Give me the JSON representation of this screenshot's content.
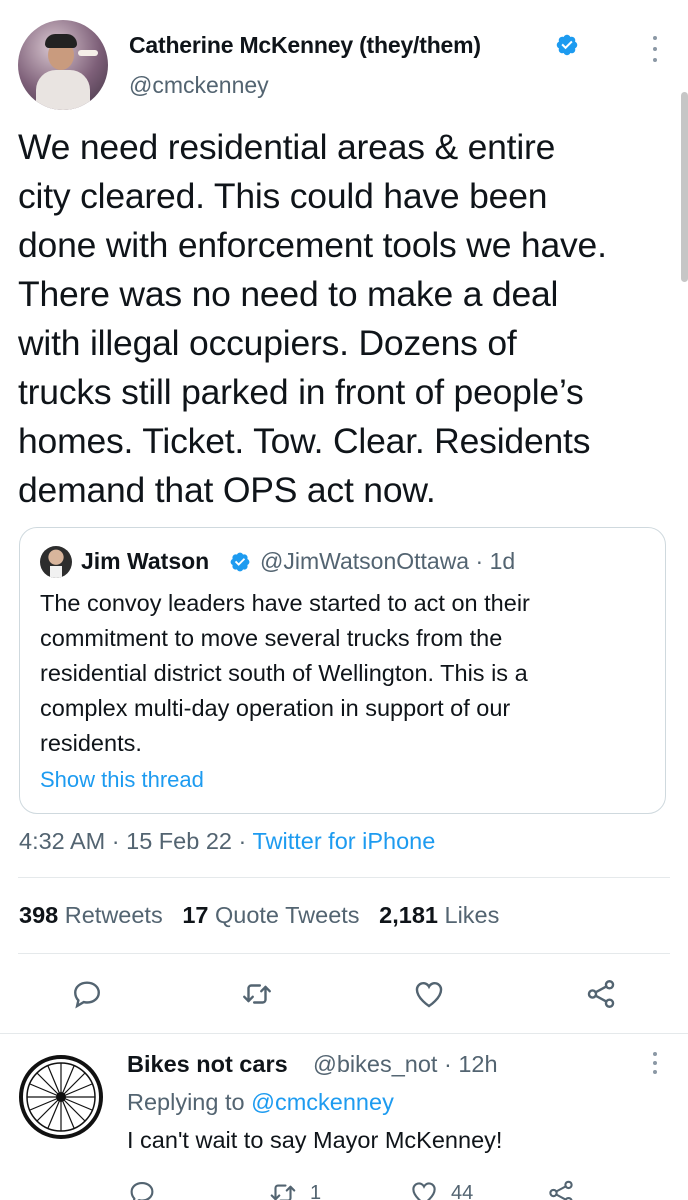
{
  "tweet": {
    "author_name": "Catherine McKenney (they/them)",
    "author_handle": "@cmckenney",
    "text": "We need residential areas & entire\ncity cleared. This could have been\ndone with enforcement tools we have.\nThere was no need to make a deal\nwith illegal occupiers. Dozens of\ntrucks still parked in front of people’s\nhomes. Ticket. Tow. Clear. Residents\ndemand that OPS act now.",
    "time": "4:32 AM",
    "date": "15 Feb 22",
    "source": "Twitter for iPhone",
    "retweets_count": "398",
    "retweets_label": "Retweets",
    "quotes_count": "17",
    "quotes_label": "Quote Tweets",
    "likes_count": "2,181",
    "likes_label": "Likes"
  },
  "quote": {
    "author_name": "Jim Watson",
    "author_handle": "@JimWatsonOttawa",
    "age": "1d",
    "text": "The convoy leaders have started to act on their\ncommitment to move several trucks from the\nresidential district south of Wellington. This is a\ncomplex multi-day operation in support of our\nresidents.",
    "show_thread": "Show this thread"
  },
  "reply": {
    "author_name": "Bikes not cars",
    "author_handle": "@bikes_not",
    "age": "12h",
    "replying_prefix": "Replying to",
    "replying_to": "@cmckenney",
    "text": "I can't wait to say Mayor McKenney!",
    "retweets": "1",
    "likes": "44"
  },
  "colors": {
    "text": "#0f1419",
    "secondary": "#536471",
    "accent": "#1d9bf0",
    "border": "#cfd9de"
  },
  "icons": [
    "verified-icon",
    "more-icon",
    "reply-icon",
    "retweet-icon",
    "like-icon",
    "share-icon"
  ]
}
